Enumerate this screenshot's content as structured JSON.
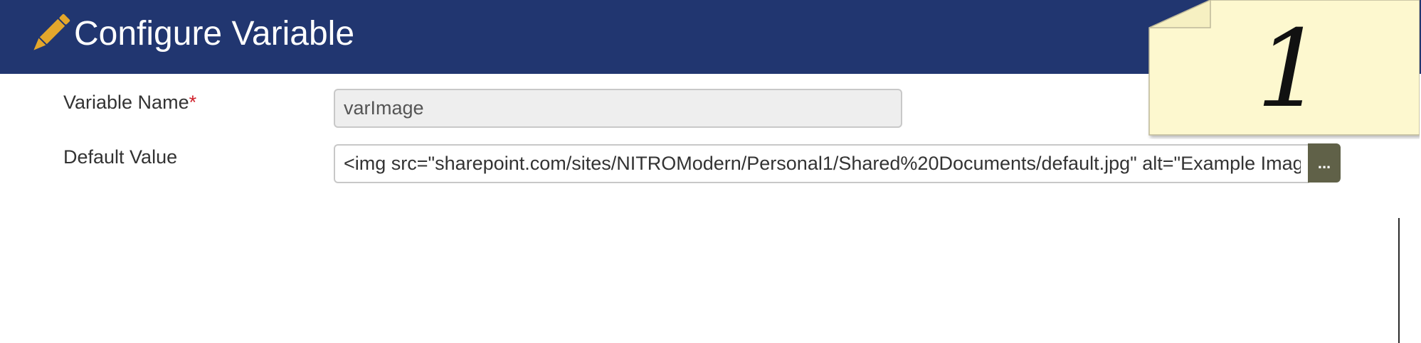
{
  "header": {
    "title": "Configure Variable",
    "icon": "pencil-icon",
    "background_color": "#213670",
    "icon_color": "#e4a72b"
  },
  "form": {
    "variable_name": {
      "label": "Variable Name",
      "required_marker": "*",
      "value": "varImage"
    },
    "default_value": {
      "label": "Default Value",
      "value": "<img src=\"sharepoint.com/sites/NITROModern/Personal1/Shared%20Documents/default.jpg\" alt=\"Example Image\">",
      "browse_label": "...",
      "browse_color": "#606148"
    },
    "required_color": "#d0202a"
  },
  "sticky_note": {
    "number": "1",
    "color": "#fdf8cf"
  }
}
